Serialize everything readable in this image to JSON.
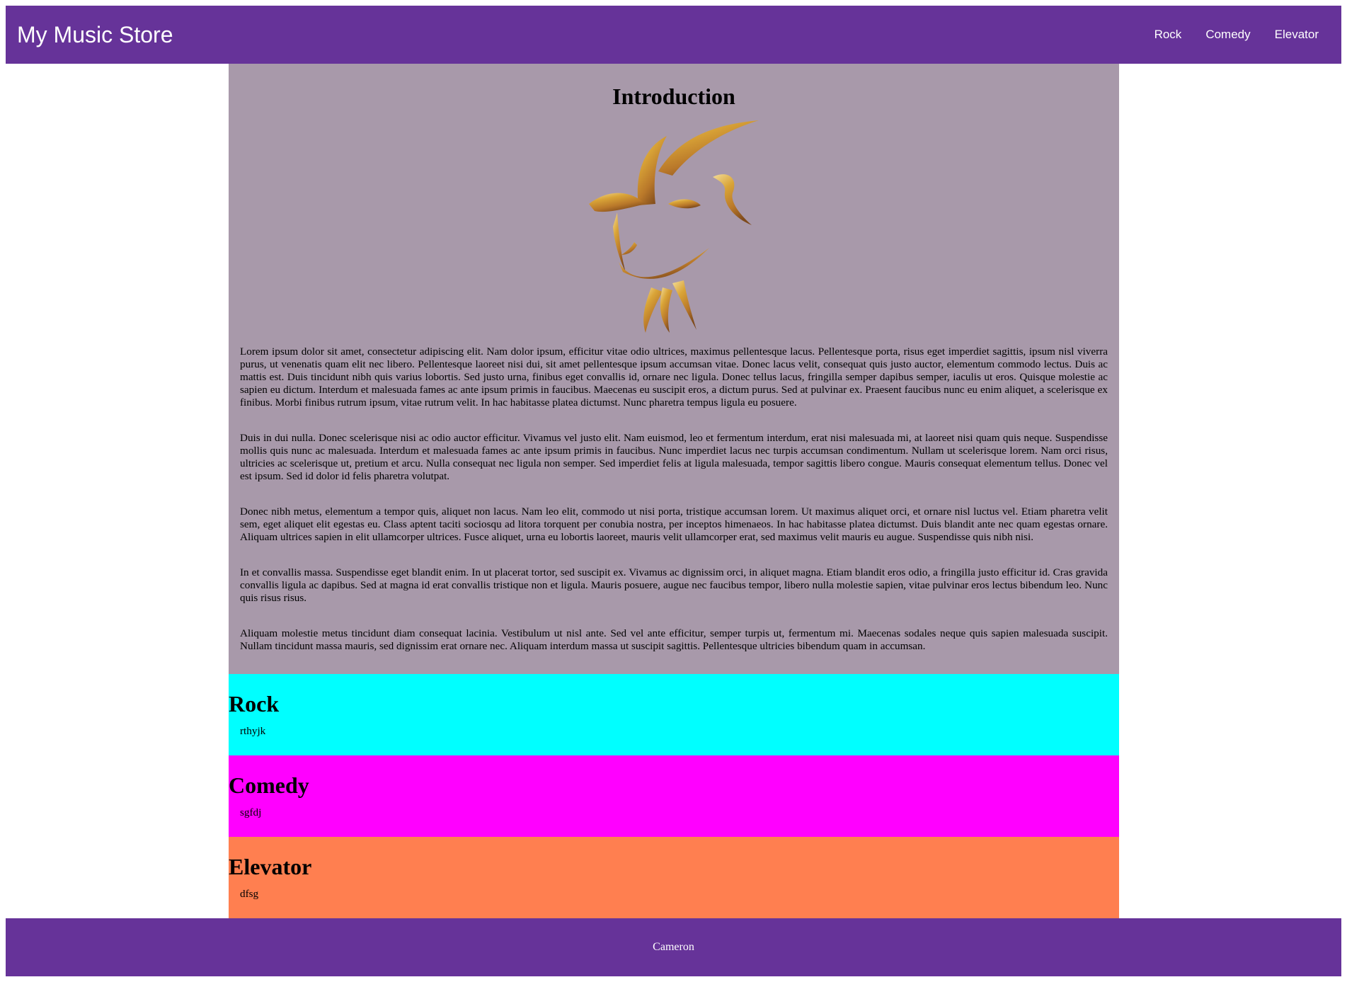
{
  "header": {
    "title": "My Music Store",
    "nav": [
      "Rock",
      "Comedy",
      "Elevator"
    ]
  },
  "intro": {
    "heading": "Introduction",
    "image_icon": "goat-head-logo",
    "paragraphs": [
      "Lorem ipsum dolor sit amet, consectetur adipiscing elit. Nam dolor ipsum, efficitur vitae odio ultrices, maximus pellentesque lacus. Pellentesque porta, risus eget imperdiet sagittis, ipsum nisl viverra purus, ut venenatis quam elit nec libero. Pellentesque laoreet nisi dui, sit amet pellentesque ipsum accumsan vitae. Donec lacus velit, consequat quis justo auctor, elementum commodo lectus. Duis ac mattis est. Duis tincidunt nibh quis varius lobortis. Sed justo urna, finibus eget convallis id, ornare nec ligula. Donec tellus lacus, fringilla semper dapibus semper, iaculis ut eros. Quisque molestie ac sapien eu dictum. Interdum et malesuada fames ac ante ipsum primis in faucibus. Maecenas eu suscipit eros, a dictum purus. Sed at pulvinar ex. Praesent faucibus nunc eu enim aliquet, a scelerisque ex finibus. Morbi finibus rutrum ipsum, vitae rutrum velit. In hac habitasse platea dictumst. Nunc pharetra tempus ligula eu posuere.",
      "Duis in dui nulla. Donec scelerisque nisi ac odio auctor efficitur. Vivamus vel justo elit. Nam euismod, leo et fermentum interdum, erat nisi malesuada mi, at laoreet nisi quam quis neque. Suspendisse mollis quis nunc ac malesuada. Interdum et malesuada fames ac ante ipsum primis in faucibus. Nunc imperdiet lacus nec turpis accumsan condimentum. Nullam ut scelerisque lorem. Nam orci risus, ultricies ac scelerisque ut, pretium et arcu. Nulla consequat nec ligula non semper. Sed imperdiet felis at ligula malesuada, tempor sagittis libero congue. Mauris consequat elementum tellus. Donec vel est ipsum. Sed id dolor id felis pharetra volutpat.",
      "Donec nibh metus, elementum a tempor quis, aliquet non lacus. Nam leo elit, commodo ut nisi porta, tristique accumsan lorem. Ut maximus aliquet orci, et ornare nisl luctus vel. Etiam pharetra velit sem, eget aliquet elit egestas eu. Class aptent taciti sociosqu ad litora torquent per conubia nostra, per inceptos himenaeos. In hac habitasse platea dictumst. Duis blandit ante nec quam egestas ornare. Aliquam ultrices sapien in elit ullamcorper ultrices. Fusce aliquet, urna eu lobortis laoreet, mauris velit ullamcorper erat, sed maximus velit mauris eu augue. Suspendisse quis nibh nisi.",
      "In et convallis massa. Suspendisse eget blandit enim. In ut placerat tortor, sed suscipit ex. Vivamus ac dignissim orci, in aliquet magna. Etiam blandit eros odio, a fringilla justo efficitur id. Cras gravida convallis ligula ac dapibus. Sed at magna id erat convallis tristique non et ligula. Mauris posuere, augue nec faucibus tempor, libero nulla molestie sapien, vitae pulvinar eros lectus bibendum leo. Nunc quis risus risus.",
      "Aliquam molestie metus tincidunt diam consequat lacinia. Vestibulum ut nisl ante. Sed vel ante efficitur, semper turpis ut, fermentum mi. Maecenas sodales neque quis sapien malesuada suscipit. Nullam tincidunt massa mauris, sed dignissim erat ornare nec. Aliquam interdum massa ut suscipit sagittis. Pellentesque ultricies bibendum quam in accumsan."
    ]
  },
  "sections": [
    {
      "heading": "Rock",
      "text": "rthyjk",
      "color": "#00ffff"
    },
    {
      "heading": "Comedy",
      "text": "sgfdj",
      "color": "#ff00ff"
    },
    {
      "heading": "Elevator",
      "text": "dfsg",
      "color": "#ff7f50"
    }
  ],
  "footer": {
    "text": "Cameron"
  },
  "colors": {
    "header_bg": "#663399",
    "intro_bg": "#a899aa"
  }
}
